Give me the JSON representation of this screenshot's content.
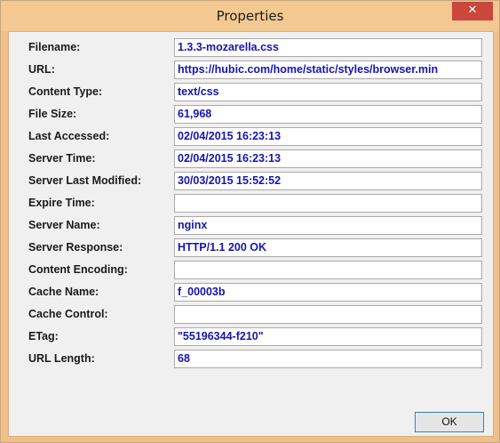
{
  "window": {
    "title": "Properties",
    "close_glyph": "✕",
    "close_icon": "close-icon"
  },
  "fields": [
    {
      "label": "Filename:",
      "value": "1.3.3-mozarella.css"
    },
    {
      "label": "URL:",
      "value": "https://hubic.com/home/static/styles/browser.min"
    },
    {
      "label": "Content Type:",
      "value": "text/css"
    },
    {
      "label": "File Size:",
      "value": "61,968"
    },
    {
      "label": "Last Accessed:",
      "value": "02/04/2015 16:23:13"
    },
    {
      "label": "Server Time:",
      "value": "02/04/2015 16:23:13"
    },
    {
      "label": "Server Last Modified:",
      "value": "30/03/2015 15:52:52"
    },
    {
      "label": "Expire Time:",
      "value": ""
    },
    {
      "label": "Server Name:",
      "value": "nginx"
    },
    {
      "label": "Server Response:",
      "value": "HTTP/1.1 200 OK"
    },
    {
      "label": "Content Encoding:",
      "value": ""
    },
    {
      "label": "Cache Name:",
      "value": "f_00003b"
    },
    {
      "label": "Cache Control:",
      "value": ""
    },
    {
      "label": "ETag:",
      "value": "\"55196344-f210\""
    },
    {
      "label": "URL Length:",
      "value": "68"
    }
  ],
  "buttons": {
    "ok_label": "OK"
  },
  "colors": {
    "title_bar": "#f3c891",
    "close_button": "#c9473b",
    "value_text": "#1515b0",
    "dialog_background": "#f0f0f0"
  }
}
